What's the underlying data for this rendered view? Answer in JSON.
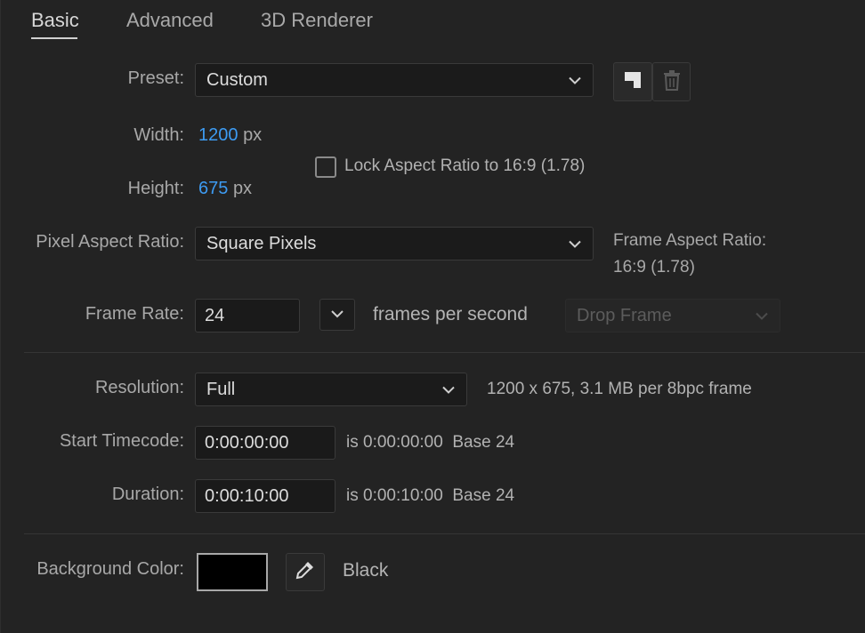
{
  "tabs": [
    {
      "label": "Basic",
      "active": true
    },
    {
      "label": "Advanced",
      "active": false
    },
    {
      "label": "3D Renderer",
      "active": false
    }
  ],
  "preset": {
    "label": "Preset:",
    "value": "Custom"
  },
  "width": {
    "label": "Width:",
    "value": "1200",
    "unit": "px"
  },
  "height": {
    "label": "Height:",
    "value": "675",
    "unit": "px"
  },
  "lock_aspect": {
    "label": "Lock Aspect Ratio to 16:9 (1.78)",
    "checked": false
  },
  "pixel_aspect": {
    "label": "Pixel Aspect Ratio:",
    "value": "Square Pixels"
  },
  "frame_aspect": {
    "label": "Frame Aspect Ratio:",
    "value": "16:9 (1.78)"
  },
  "frame_rate": {
    "label": "Frame Rate:",
    "value": "24",
    "suffix": "frames per second",
    "drop_frame": "Drop Frame"
  },
  "resolution": {
    "label": "Resolution:",
    "value": "Full",
    "info": "1200 x 675, 3.1 MB per 8bpc frame"
  },
  "start_timecode": {
    "label": "Start Timecode:",
    "value": "0:00:00:00",
    "info": "is 0:00:00:00  Base 24"
  },
  "duration": {
    "label": "Duration:",
    "value": "0:00:10:00",
    "info": "is 0:00:10:00  Base 24"
  },
  "background": {
    "label": "Background Color:",
    "color": "#000000",
    "name": "Black"
  },
  "icons": {
    "preset_save": "save-preset-icon",
    "preset_delete": "trash-icon",
    "chevron": "chevron-down-icon",
    "eyedropper": "eyedropper-icon"
  },
  "colors": {
    "accent_value": "#3d9bf2",
    "background": "#232323"
  }
}
